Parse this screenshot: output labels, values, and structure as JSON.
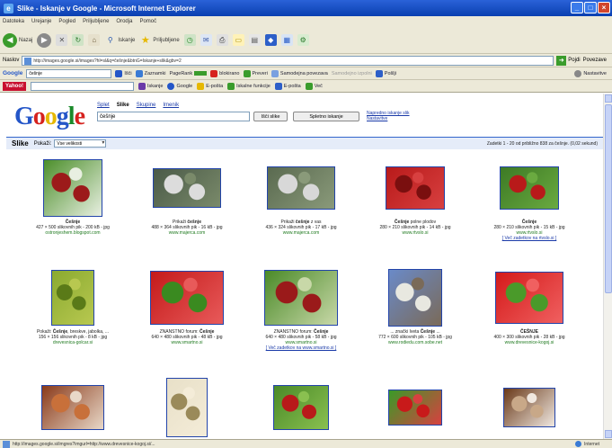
{
  "window": {
    "title": "Slike - Iskanje v Google - Microsoft Internet Explorer",
    "icon": "ie-icon"
  },
  "menu": [
    "Datoteka",
    "Urejanje",
    "Pogled",
    "Priljubljene",
    "Orodja",
    "Pomoč"
  ],
  "toolbar": {
    "back": "Nazaj",
    "search": "Iskanje",
    "favorites": "Priljubljene"
  },
  "address": {
    "label": "Naslov",
    "url": "http://images.google.si/images?hl=sl&q=češnje&btnG=Iskanje+slik&gbv=2",
    "go": "Pojdi",
    "links": "Povezave"
  },
  "googlebar": {
    "brand": "Google",
    "query": "češnje",
    "search_btn": "Išči",
    "bookmarks": "Zaznamki",
    "pagerank": "PageRank",
    "blocked": "blokirano",
    "check": "Preveri",
    "autolink": "Samodejna povezava",
    "autofill": "Samodejno izpolni",
    "send": "Pošlji",
    "settings": "Nastavitve"
  },
  "yahoobar": {
    "brand": "Yahoo!",
    "search": "Iskanje",
    "google": "Google",
    "mail": "E-pošta",
    "webcam": "Iskanje",
    "webcam_label": "Iskalne funkcije",
    "email": "E-pošta",
    "more": "Več"
  },
  "google": {
    "logo": "Google",
    "tabs": [
      "Splet",
      "Slike",
      "Skupine",
      "Imenik"
    ],
    "active_tab": "Slike",
    "query": "češnje",
    "search_btn": "Išči slike",
    "web_btn": "Spletno iskanje",
    "advanced": "Napredno iskanje slik Nastavitve"
  },
  "results_bar": {
    "label": "Slike",
    "show_label": "Pokaži:",
    "show_value": "Vse velikosti",
    "stats": "Zadetki 1 - 20 od približno 838 za češnje. (0,02 sekund)"
  },
  "results": [
    {
      "caption_pre": "",
      "caption_bold": "Češnje",
      "caption_post": "",
      "meta": "427 × 500 slikovnih pik - 200 kB - jpg",
      "source": "ostronjeshem.blogspot.com",
      "more": "",
      "colors": [
        "#4c8f2b",
        "#9c1a1a",
        "#e8efe1"
      ]
    },
    {
      "caption_pre": "Prikaži ",
      "caption_bold": "češnje",
      "caption_post": "",
      "meta": "488 × 364 slikovnih pik - 16 kB - jpg",
      "source": "www.majerca.com",
      "more": "",
      "colors": [
        "#4a5a48",
        "#dcdcdc",
        "#7a8a6a"
      ]
    },
    {
      "caption_pre": "Prikaži ",
      "caption_bold": "češnje",
      "caption_post": " z vas",
      "meta": "436 × 324 slikovnih pik - 17 kB - jpg",
      "source": "www.majerca.com",
      "more": "",
      "colors": [
        "#5a6a50",
        "#d8d8d8",
        "#8a9a7a"
      ]
    },
    {
      "caption_pre": "",
      "caption_bold": "Češnje",
      "caption_post": " polne plodov",
      "meta": "280 × 210 slikovnih pik - 14 kB - jpg",
      "source": "www.rtvslo.si",
      "more": "",
      "colors": [
        "#b81a1a",
        "#7a0f0f",
        "#d84040"
      ]
    },
    {
      "caption_pre": "",
      "caption_bold": "Češnje",
      "caption_post": "",
      "meta": "280 × 210 slikovnih pik - 15 kB - jpg",
      "source": "www.rtvslo.si",
      "more": "[ Več zadetkov na rtvslo.si ]",
      "colors": [
        "#3d7a25",
        "#b81a1a",
        "#6aaa40"
      ]
    },
    {
      "caption_pre": "Pokaži: ",
      "caption_bold": "Češnje",
      "caption_post": ", breskve, jabolka, ...",
      "meta": "156 × 156 slikovnih pik - 8 kB - jpg",
      "source": "drevesnica-golcar.si",
      "more": "",
      "colors": [
        "#8aaa30",
        "#5a7a18",
        "#b8c850"
      ]
    },
    {
      "caption_pre": "ZNANSTNO forum: ",
      "caption_bold": "Češnje",
      "caption_post": "",
      "meta": "640 × 480 slikovnih pik - 48 kB - jpg",
      "source": "www.smartno.si",
      "more": "",
      "colors": [
        "#c41a1a",
        "#3a8a20",
        "#e85a5a"
      ]
    },
    {
      "caption_pre": "ZNANSTNO forum: ",
      "caption_bold": "Češnje",
      "caption_post": "",
      "meta": "640 × 480 slikovnih pik - 58 kB - jpg",
      "source": "www.smartno.si",
      "more": "[ Več zadetkov na www.smartno.si ]",
      "colors": [
        "#4a8a28",
        "#9a1a1a",
        "#c8d8a8"
      ]
    },
    {
      "caption_pre": "... znački Iveta ",
      "caption_bold": "Češnje",
      "caption_post": " ...",
      "meta": "772 × 600 slikovnih pik - 105 kB - jpg",
      "source": "www.rodiedu.com.sobe.net",
      "more": "",
      "colors": [
        "#6a8ac8",
        "#e8e8e0",
        "#7a6a58"
      ]
    },
    {
      "caption_pre": "",
      "caption_bold": "ČEŠNJE",
      "caption_post": "",
      "meta": "400 × 300 slikovnih pik - 28 kB - jpg",
      "source": "www.drevesnice-kogoj.si",
      "more": "",
      "colors": [
        "#d41a1a",
        "#4a9a2a",
        "#f06060"
      ]
    },
    {
      "caption_pre": "",
      "caption_bold": "",
      "caption_post": "",
      "meta": "",
      "source": "",
      "more": "",
      "colors": [
        "#8a3a1a",
        "#c8703a",
        "#e8d8c8"
      ]
    },
    {
      "caption_pre": "",
      "caption_bold": "",
      "caption_post": "",
      "meta": "",
      "source": "",
      "more": "",
      "colors": [
        "#e8e0c8",
        "#9a8a5a",
        "#f4ecd8"
      ]
    },
    {
      "caption_pre": "",
      "caption_bold": "",
      "caption_post": "",
      "meta": "",
      "source": "",
      "more": "",
      "colors": [
        "#4a8a28",
        "#b81a1a",
        "#8ac050"
      ]
    },
    {
      "caption_pre": "",
      "caption_bold": "",
      "caption_post": "",
      "meta": "",
      "source": "",
      "more": "",
      "colors": [
        "#3a9a28",
        "#c81a1a",
        "#d84040"
      ]
    },
    {
      "caption_pre": "",
      "caption_bold": "",
      "caption_post": "",
      "meta": "",
      "source": "",
      "more": "",
      "colors": [
        "#6a3a1a",
        "#c8a888",
        "#f0e8e0"
      ]
    }
  ],
  "statusbar": {
    "text": "http://images.google.si/imgres?imgurl=http://www.drevesnice-kogoj.si/...",
    "zone": "Internet"
  }
}
